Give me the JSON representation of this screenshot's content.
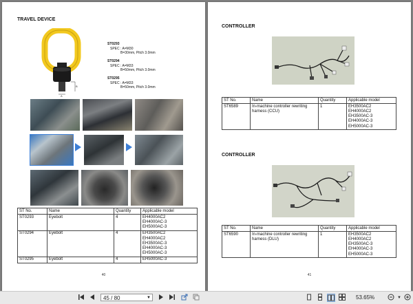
{
  "left_page": {
    "title": "TRAVEL DEVICE",
    "specs": [
      {
        "id": "ST0293",
        "line1": "SPEC : A=M30",
        "line2": "B=30mm, Pitch 3.0mm"
      },
      {
        "id": "ST0294",
        "line1": "SPEC : A=M33",
        "line2": "B=50mm, Pitch 3.0mm"
      },
      {
        "id": "ST0295",
        "line1": "SPEC : A=M33",
        "line2": "B=50mm, Pitch 3.0mm"
      }
    ],
    "dim_a": "A",
    "dim_b": "B",
    "table": {
      "headers": [
        "ST No.",
        "Name",
        "Quantity",
        "Applicable model"
      ],
      "rows": [
        {
          "st": "ST0293",
          "name": "Eyebolt",
          "qty": "4",
          "models": "EH4000AC2\nEH4000AC-3\nEH5000AC-3"
        },
        {
          "st": "ST0294",
          "name": "Eyebolt",
          "qty": "4",
          "models": "EH3500AC2\nEH4000AC2\nEH3500AC-3\nEH4000AC-3\nEH5000AC-3"
        },
        {
          "st": "ST0295",
          "name": "Eyebolt",
          "qty": "4",
          "models": "EH5000AC-3"
        }
      ]
    },
    "page_number": "40"
  },
  "right_page": {
    "sections": [
      {
        "title": "CONTROLLER",
        "table": {
          "headers": [
            "ST No.",
            "Name",
            "Quantity",
            "Applicable model"
          ],
          "rows": [
            {
              "st": "ST6589",
              "name": "In-machine controller rewriting harness (CCU)",
              "qty": "1",
              "models": "EH3500AC2\nEH4000AC2\nEH3500AC-3\nEH4000AC-3\nEH5000AC-3"
            }
          ]
        }
      },
      {
        "title": "CONTROLLER",
        "table": {
          "headers": [
            "ST No.",
            "Name",
            "Quantity",
            "Applicable model"
          ],
          "rows": [
            {
              "st": "ST6590",
              "name": "In-machine controller rewriting harness (DLU)",
              "qty": "1",
              "models": "EH3500AC2\nEH4000AC2\nEH3500AC-3\nEH4000AC-3\nEH5000AC-3"
            }
          ]
        }
      }
    ],
    "page_number": "41"
  },
  "toolbar": {
    "page_field": "45 / 80",
    "zoom": "53.65%"
  },
  "colors": {
    "eyebolt_yellow": "#f2c81e",
    "arrow_blue": "#3d7fd6",
    "viewer_bg": "#808080",
    "toolbar_bg": "#e9e9e9"
  }
}
